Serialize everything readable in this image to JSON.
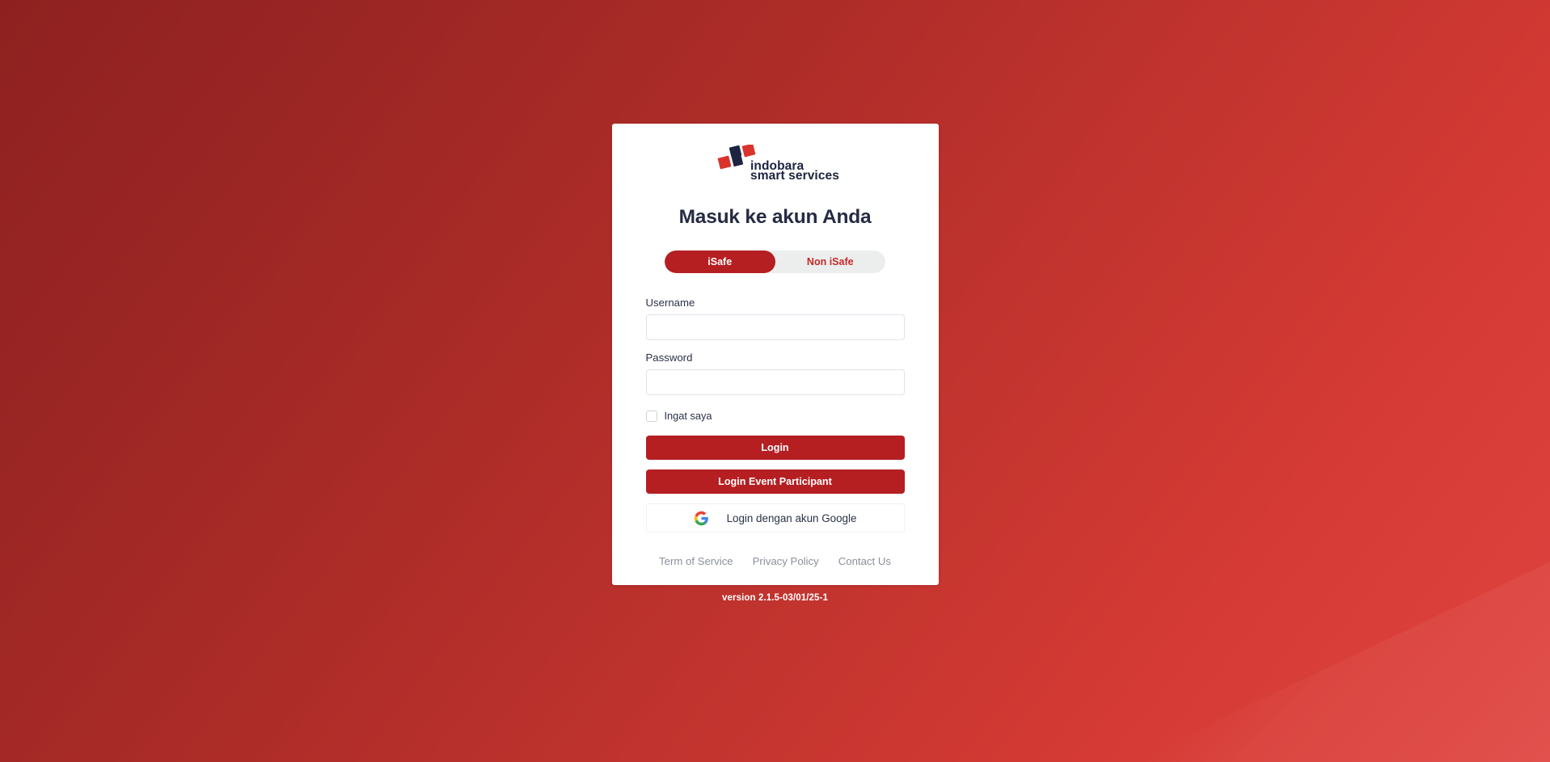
{
  "background": {
    "gradient_from": "#8e2120",
    "gradient_to": "#e04440"
  },
  "brand": {
    "logo_icon": "indobara-logo-icon",
    "name_line1": "indobara",
    "name_line2": "smart services",
    "mark_color_red": "#d9342c",
    "mark_color_navy": "#1d2440",
    "text_color": "#252b42"
  },
  "card": {
    "title": "Masuk ke akun Anda"
  },
  "toggle": {
    "options": [
      {
        "label": "iSafe",
        "active": true
      },
      {
        "label": "Non iSafe",
        "active": false
      }
    ],
    "active_bg": "#b51f22",
    "track_bg": "#eceded",
    "inactive_text": "#c22a2a"
  },
  "form": {
    "username": {
      "label": "Username",
      "value": "",
      "placeholder": ""
    },
    "password": {
      "label": "Password",
      "value": "",
      "placeholder": ""
    },
    "remember": {
      "label": "Ingat saya",
      "checked": false
    }
  },
  "actions": {
    "login": "Login",
    "login_event_participant": "Login Event Participant",
    "google": {
      "icon": "google-g-icon",
      "label": "Login dengan akun Google"
    },
    "primary_color": "#b51f22"
  },
  "footer": {
    "links": [
      {
        "label": "Term of Service"
      },
      {
        "label": "Privacy Policy"
      },
      {
        "label": "Contact Us"
      }
    ],
    "link_color": "#8a9099"
  },
  "version": {
    "text": "version 2.1.5-03/01/25-1"
  }
}
